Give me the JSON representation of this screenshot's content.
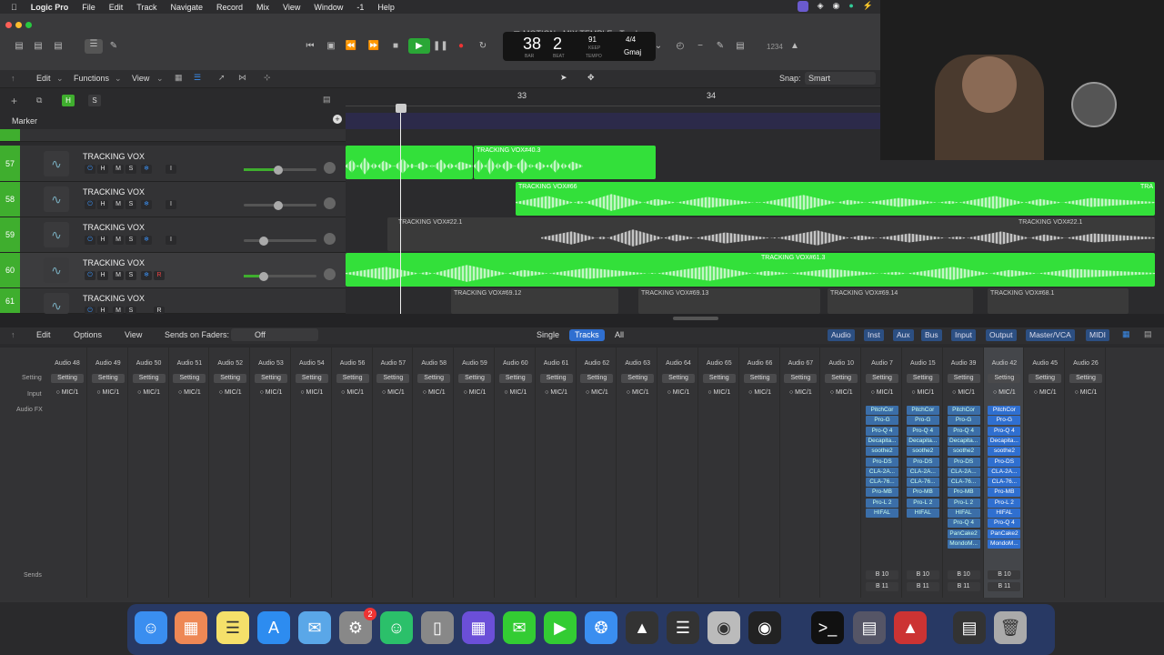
{
  "menubar": {
    "app_name": "Logic Pro",
    "items": [
      "File",
      "Edit",
      "Track",
      "Navigate",
      "Record",
      "Mix",
      "View",
      "Window",
      "-1",
      "Help"
    ]
  },
  "window": {
    "title": "MOTION - MIX TEMPLE - Tracks"
  },
  "lcd": {
    "bar": "38",
    "beat": "2",
    "bar_label": "BAR",
    "beat_label": "BEAT",
    "tempo": "91",
    "keep_label": "KEEP",
    "tempo_label": "TEMPO",
    "signature": "4/4",
    "key": "Gmaj"
  },
  "counter": "1234",
  "tracks_toolbar": {
    "edit": "Edit",
    "functions": "Functions",
    "view": "View",
    "snap_label": "Snap:",
    "snap_value": "Smart"
  },
  "header_buttons": {
    "add": "+",
    "h": "H",
    "s": "S"
  },
  "ruler": {
    "bar33": "33",
    "bar34": "34"
  },
  "marker_label": "Marker",
  "tracks": [
    {
      "num": "57",
      "name": "TRACKING VOX",
      "rec": "I"
    },
    {
      "num": "58",
      "name": "TRACKING VOX",
      "rec": "I"
    },
    {
      "num": "59",
      "name": "TRACKING VOX",
      "rec": "I"
    },
    {
      "num": "60",
      "name": "TRACKING VOX",
      "rec": "R"
    },
    {
      "num": "61",
      "name": "TRACKING VOX",
      "rec": "R"
    }
  ],
  "track_btn_labels": {
    "h": "H",
    "m": "M",
    "s": "S",
    "r": "R"
  },
  "regions": {
    "r57a": "TRACKING VOX#40.3",
    "r58a": "TRACKING VOX#66",
    "r58b": "TRA",
    "r59a": "TRACKING VOX#22.1",
    "r59b": "TRACKING VOX#22.1",
    "r60a": "TRACKING VOX#61.3",
    "r61a": "TRACKING VOX#69.12",
    "r61b": "TRACKING VOX#69.13",
    "r61c": "TRACKING VOX#69.14",
    "r61d": "TRACKING VOX#68.1"
  },
  "mixer_toolbar": {
    "edit": "Edit",
    "options": "Options",
    "view": "View",
    "sends_on_faders": "Sends on Faders:",
    "off": "Off",
    "single": "Single",
    "tracks": "Tracks",
    "all": "All",
    "filters": [
      "Audio",
      "Inst",
      "Aux",
      "Bus",
      "Input",
      "Output",
      "Master/VCA",
      "MIDI"
    ]
  },
  "mixer_labels": {
    "setting": "Setting",
    "input": "Input",
    "audio_fx": "Audio FX",
    "sends": "Sends"
  },
  "channel_names": [
    "Audio 48",
    "Audio 49",
    "Audio 50",
    "Audio 51",
    "Audio 52",
    "Audio 53",
    "Audio 54",
    "Audio 56",
    "Audio 57",
    "Audio 58",
    "Audio 59",
    "Audio 60",
    "Audio 61",
    "Audio 62",
    "Audio 63",
    "Audio 64",
    "Audio 65",
    "Audio 66",
    "Audio 67",
    "Audio 10",
    "Audio 7",
    "Audio 15",
    "Audio 39",
    "Audio 42",
    "Audio 45",
    "Audio 26"
  ],
  "channel_setting": "Setting",
  "channel_input": "MIC/1",
  "fx_chains": {
    "short": [
      "PitchCor",
      "Pro-G",
      "Pro-Q 4",
      "Decapita...",
      "soothe2",
      "Pro-DS",
      "CLA-2A...",
      "CLA-76...",
      "Pro-MB",
      "Pro-L 2",
      "HIFAL"
    ],
    "long": [
      "PitchCor",
      "Pro-G",
      "Pro-Q 4",
      "Decapita...",
      "soothe2",
      "Pro-DS",
      "CLA-2A...",
      "CLA-76...",
      "Pro-MB",
      "Pro-L 2",
      "HIFAL",
      "Pro-Q 4",
      "PanCake2",
      "MondoM..."
    ]
  },
  "sends": [
    "B 10",
    "B 11"
  ],
  "dock_badge": "2",
  "colors": {
    "region_green": "#33e03a",
    "track_num_green": "#3fae2e",
    "accent_blue": "#2f6fd0"
  }
}
